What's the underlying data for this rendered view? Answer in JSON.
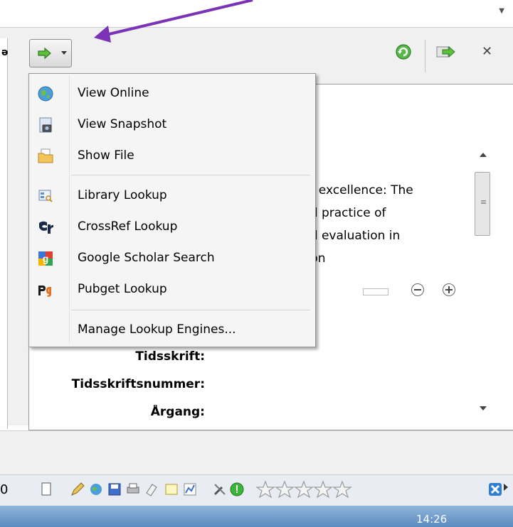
{
  "menu": {
    "items": [
      {
        "label": "View Online",
        "icon": "globe-icon"
      },
      {
        "label": "View Snapshot",
        "icon": "snapshot-icon"
      },
      {
        "label": "Show File",
        "icon": "folder-icon"
      },
      {
        "label": "Library Lookup",
        "icon": "library-icon"
      },
      {
        "label": "CrossRef Lookup",
        "icon": "crossref-icon"
      },
      {
        "label": "Google Scholar Search",
        "icon": "google-scholar-icon"
      },
      {
        "label": "Pubget Lookup",
        "icon": "pubget-icon"
      },
      {
        "label": "Manage Lookup Engines...",
        "icon": ""
      }
    ]
  },
  "content": {
    "title_lines": [
      "or excellence: The",
      "nd practice of",
      "nd evaluation in",
      "tion"
    ]
  },
  "fields": {
    "journal": "Tidsskrift:",
    "journal_abbr": "Tidsskriftsnummer:",
    "volume": "Årgang:"
  },
  "left_stub": {
    "mark": "ǝ"
  },
  "bottom": {
    "left_digit": "0",
    "clock": "14:26"
  },
  "colors": {
    "annotation_arrow": "#7a33b5",
    "accent_green": "#3cb43c"
  }
}
